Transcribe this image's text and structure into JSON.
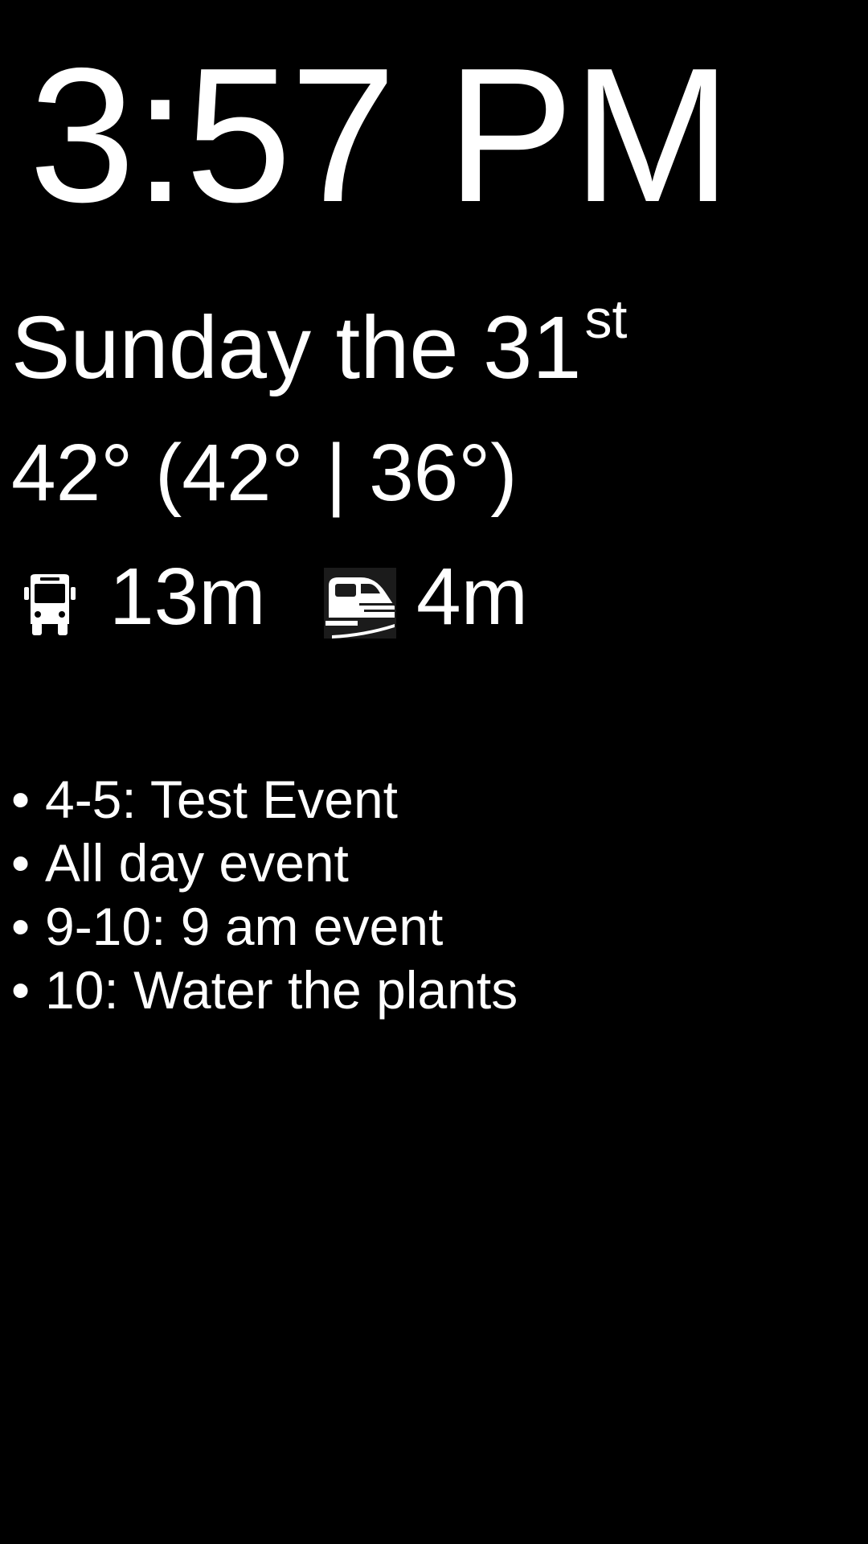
{
  "clock": {
    "time": "3:57 PM"
  },
  "date": {
    "text": "Sunday the 31",
    "suffix": "st"
  },
  "weather": {
    "text": "42° (42° | 36°)"
  },
  "transit": {
    "bus": {
      "icon": "bus-icon",
      "eta": "13m"
    },
    "train": {
      "icon": "train-icon",
      "eta": "4m"
    }
  },
  "events": {
    "bullet": "•",
    "items": [
      {
        "text": "4-5: Test Event"
      },
      {
        "text": "All day event"
      },
      {
        "text": "9-10: 9 am event"
      },
      {
        "text": "10: Water the plants"
      }
    ]
  },
  "colors": {
    "background": "#000000",
    "foreground": "#ffffff"
  }
}
